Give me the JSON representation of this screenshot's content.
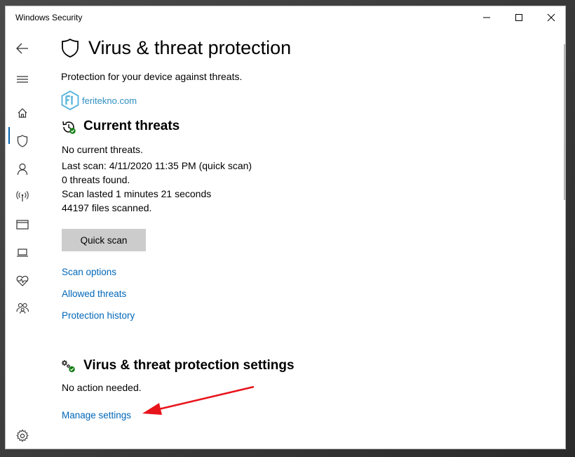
{
  "window": {
    "title": "Windows Security"
  },
  "sidebar": {
    "items": [
      {
        "name": "back",
        "icon": "back-arrow-icon"
      },
      {
        "name": "menu",
        "icon": "hamburger-icon"
      },
      {
        "name": "home",
        "icon": "home-icon"
      },
      {
        "name": "virus-protection",
        "icon": "shield-icon",
        "selected": true
      },
      {
        "name": "account",
        "icon": "person-icon"
      },
      {
        "name": "firewall",
        "icon": "antenna-icon"
      },
      {
        "name": "app-browser",
        "icon": "browser-icon"
      },
      {
        "name": "device-security",
        "icon": "laptop-icon"
      },
      {
        "name": "device-health",
        "icon": "heart-pulse-icon"
      },
      {
        "name": "family",
        "icon": "family-icon"
      },
      {
        "name": "settings",
        "icon": "gear-icon"
      }
    ]
  },
  "header": {
    "title": "Virus & threat protection",
    "subtitle": "Protection for your device against threats."
  },
  "watermark": {
    "text": "feritekno.com"
  },
  "current_threats": {
    "heading": "Current threats",
    "status": "No current threats.",
    "last_scan": "Last scan: 4/11/2020 11:35 PM (quick scan)",
    "threats_found": "0 threats found.",
    "scan_duration": "Scan lasted 1 minutes 21 seconds",
    "files_scanned": "44197 files scanned.",
    "quick_scan_label": "Quick scan",
    "links": {
      "scan_options": "Scan options",
      "allowed_threats": "Allowed threats",
      "protection_history": "Protection history"
    }
  },
  "settings_section": {
    "heading": "Virus & threat protection settings",
    "status": "No action needed.",
    "manage_link": "Manage settings"
  },
  "colors": {
    "accent": "#0067b8",
    "annotation_arrow": "#e8141b",
    "status_ok": "#107c10"
  }
}
